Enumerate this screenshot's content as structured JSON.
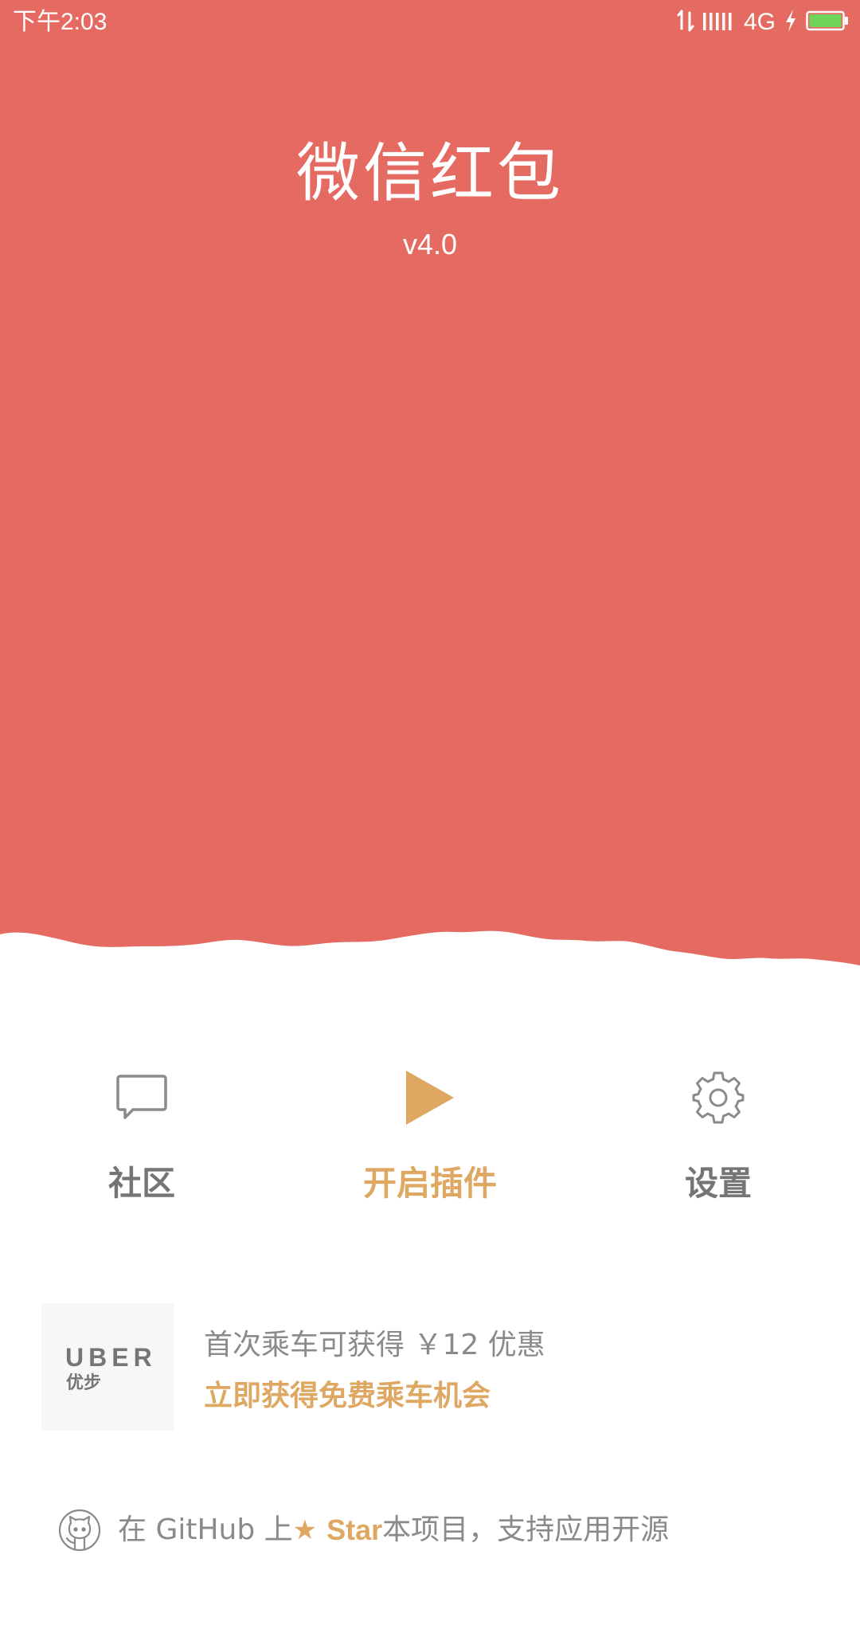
{
  "status_bar": {
    "time": "下午2:03",
    "network": "4G",
    "icons": [
      "data-transfer-icon",
      "signal-icon",
      "charging-icon",
      "battery-icon"
    ],
    "battery_color": "#6ed45a"
  },
  "header": {
    "title": "微信红包",
    "version": "v4.0"
  },
  "actions": [
    {
      "label": "社区",
      "icon": "chat-bubble-icon"
    },
    {
      "label": "开启插件",
      "icon": "play-icon"
    },
    {
      "label": "设置",
      "icon": "gear-icon"
    }
  ],
  "ad": {
    "brand": "UBER",
    "brand_cn": "优步",
    "line1": "首次乘车可获得 ￥12 优惠",
    "line2": "立即获得免费乘车机会"
  },
  "footer": {
    "prefix": "在 GitHub 上 ",
    "star_label": "Star",
    "suffix": " 本项目，支持应用开源",
    "icon": "github-icon"
  },
  "colors": {
    "primary": "#e56b62",
    "accent": "#dea762",
    "text_gray": "#757575"
  }
}
